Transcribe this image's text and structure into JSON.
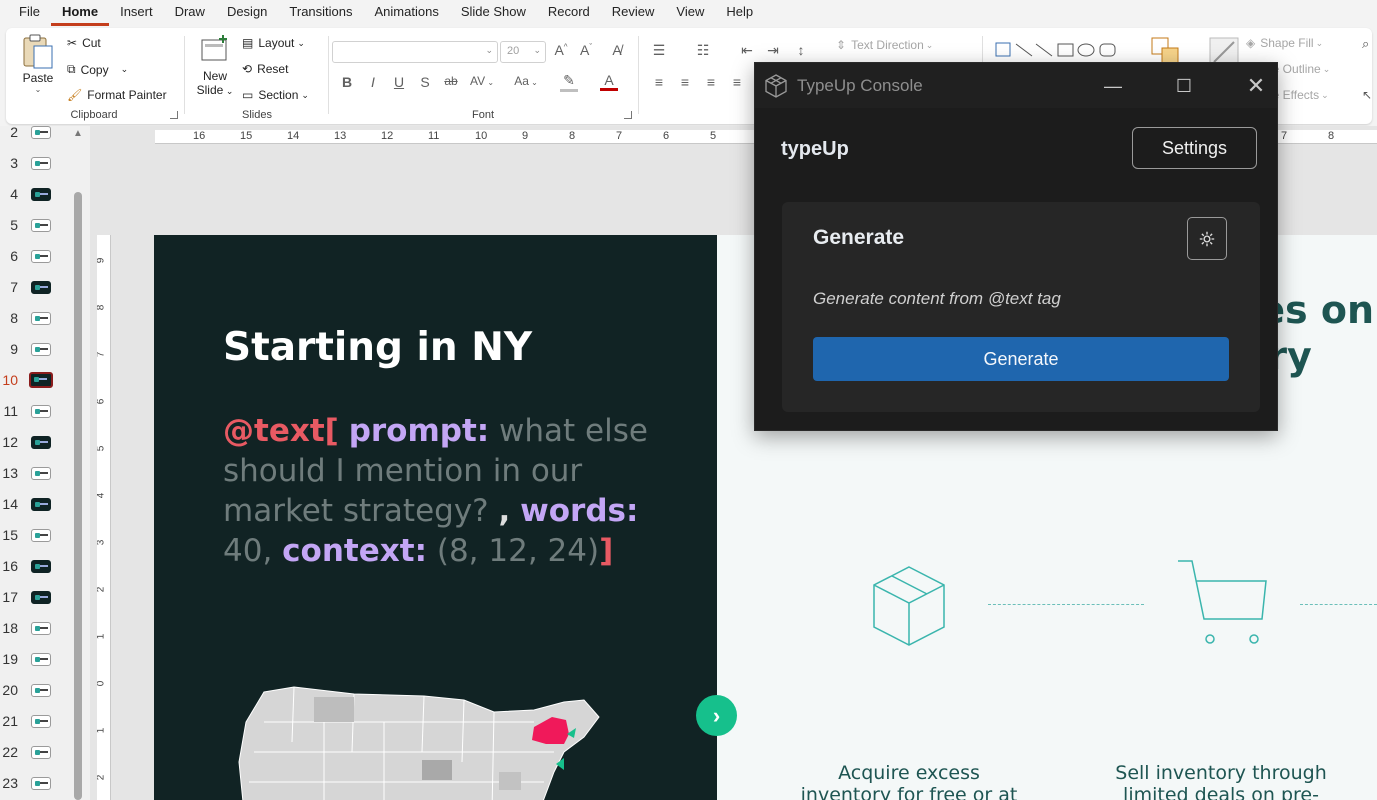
{
  "menu": [
    "File",
    "Home",
    "Insert",
    "Draw",
    "Design",
    "Transitions",
    "Animations",
    "Slide Show",
    "Record",
    "Review",
    "View",
    "Help"
  ],
  "ribbon": {
    "clipboard": {
      "paste": "Paste",
      "cut": "Cut",
      "copy": "Copy",
      "format_painter": "Format Painter",
      "label": "Clipboard"
    },
    "slides": {
      "new_slide_line1": "New",
      "new_slide_line2": "Slide",
      "layout": "Layout",
      "reset": "Reset",
      "section": "Section",
      "label": "Slides"
    },
    "font": {
      "size": "20",
      "label": "Font",
      "bold": "B",
      "italic": "I",
      "underline": "U",
      "shadow": "S",
      "strike": "ab",
      "spacing": "AV",
      "case": "Aa"
    },
    "paragraph": {
      "text_direction": "Text Direction"
    },
    "drawing": {
      "shape_fill": "Shape Fill",
      "shape_outline": "pe Outline",
      "shape_effects": "pe Effects"
    }
  },
  "thumbnails": [
    "2",
    "3",
    "4",
    "5",
    "6",
    "7",
    "8",
    "9",
    "10",
    "11",
    "12",
    "13",
    "14",
    "15",
    "16",
    "17",
    "18",
    "19",
    "20",
    "21",
    "22",
    "23"
  ],
  "active_slide": "10",
  "hruler": [
    "16",
    "15",
    "14",
    "13",
    "12",
    "11",
    "10",
    "9",
    "8",
    "7",
    "6",
    "5",
    "7",
    "8"
  ],
  "vruler": [
    "9",
    "8",
    "7",
    "6",
    "5",
    "4",
    "3",
    "2",
    "1",
    "0",
    "1",
    "2"
  ],
  "slide": {
    "title": "Starting in NY",
    "tag_open": "@text[",
    "prompt_key": "prompt:",
    "prompt_value": "what else should I mention in our market strategy?",
    "comma": ",",
    "words_key": "words:",
    "words_value": "40,",
    "context_key": "context:",
    "context_value": "(8, 12, 24)",
    "tag_close": "]",
    "right_title_line1": "es on",
    "right_title_line2": "tory",
    "caption_left_line1": "Acquire excess",
    "caption_left_line2": "inventory for free or at",
    "caption_right_line1": "Sell inventory through",
    "caption_right_line2": "limited deals on pre-",
    "accent": "#16c08c",
    "highlight_state": "#f0195a"
  },
  "console": {
    "window_title": "TypeUp Console",
    "brand": "typeUp",
    "settings": "Settings",
    "card_title": "Generate",
    "card_desc": "Generate content from @text tag",
    "generate_button": "Generate",
    "button_color": "#1f66ae"
  }
}
